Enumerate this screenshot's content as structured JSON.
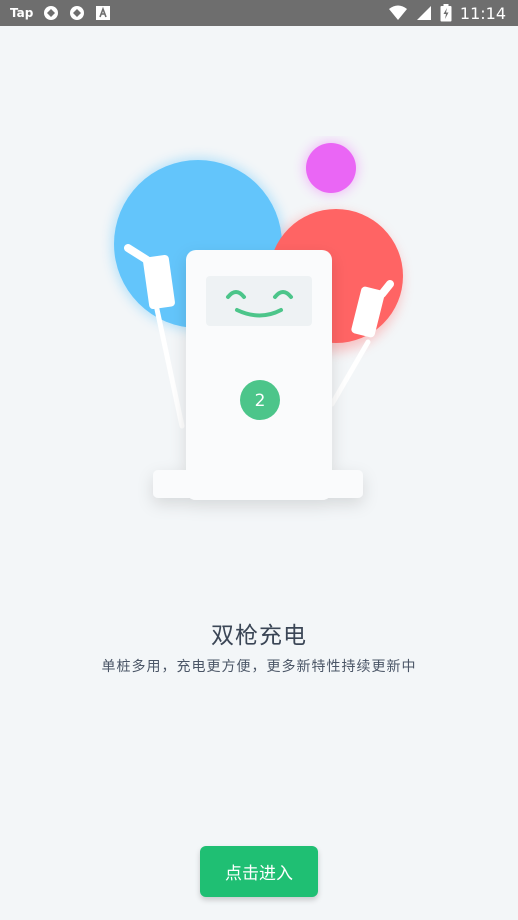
{
  "status_bar": {
    "app_label": "Tap",
    "time": "11:14",
    "background": "#6e6e6e"
  },
  "illustration": {
    "badge_number": "2",
    "colors": {
      "blue_circle": "#63c5fb",
      "red_circle": "#ff6464",
      "purple_circle": "#ea66f5",
      "face_green": "#4cc58a",
      "badge_green": "#4cc58a"
    }
  },
  "title": "双枪充电",
  "subtitle": "单桩多用，充电更方便，更多新特性持续更新中",
  "enter_button": {
    "label": "点击进入",
    "color": "#1fbf73"
  }
}
